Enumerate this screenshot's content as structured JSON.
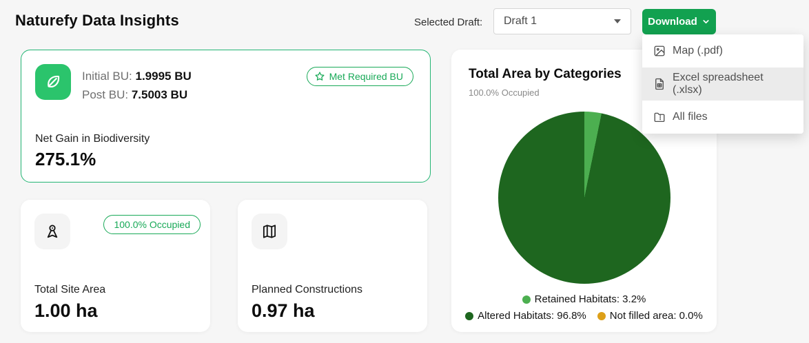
{
  "page": {
    "title": "Naturefy Data Insights"
  },
  "header": {
    "selected_draft_label": "Selected Draft:",
    "draft_select_value": "Draft 1",
    "download_label": "Download"
  },
  "download_menu": {
    "items": [
      {
        "label": "Map (.pdf)",
        "icon": "image-icon"
      },
      {
        "label": "Excel spreadsheet (.xlsx)",
        "icon": "spreadsheet-file-icon",
        "highlighted": true
      },
      {
        "label": "All files",
        "icon": "zip-folder-icon"
      }
    ]
  },
  "biodiversity_card": {
    "icon": "leaf-icon",
    "initial_bu_label": "Initial BU:",
    "initial_bu_value": "1.9995 BU",
    "post_bu_label": "Post BU:",
    "post_bu_value": "7.5003 BU",
    "badge_label": "Met Required BU",
    "badge_icon": "star-icon",
    "net_gain_label": "Net Gain in Biodiversity",
    "net_gain_value": "275.1%"
  },
  "site_area_card": {
    "icon": "location-pin-icon",
    "badge_label": "100.0% Occupied",
    "label": "Total Site Area",
    "value": "1.00 ha"
  },
  "constructions_card": {
    "icon": "folded-map-icon",
    "label": "Planned Constructions",
    "value": "0.97 ha"
  },
  "chart_data": {
    "type": "pie",
    "title": "Total Area by Categories",
    "subtitle": "100.0% Occupied",
    "slices": [
      {
        "label": "Retained Habitats",
        "value_pct": 3.2,
        "color": "#4caf50"
      },
      {
        "label": "Altered Habitats",
        "value_pct": 96.8,
        "color": "#1e661f"
      },
      {
        "label": "Not filled area",
        "value_pct": 0.0,
        "color": "#dda019"
      }
    ],
    "legend": [
      "Retained Habitats: 3.2%",
      "Altered Habitats: 96.8%",
      "Not filled area: 0.0%"
    ],
    "legend_position": "bottom",
    "start_angle_deg": 0,
    "direction": "clockwise"
  },
  "colors": {
    "accent_green": "#12a150",
    "leaf_icon_bg": "#2bc46c",
    "badge_green": "#18a957",
    "pie_retained": "#4caf50",
    "pie_altered": "#1e661f",
    "pie_not_filled": "#dda019"
  }
}
